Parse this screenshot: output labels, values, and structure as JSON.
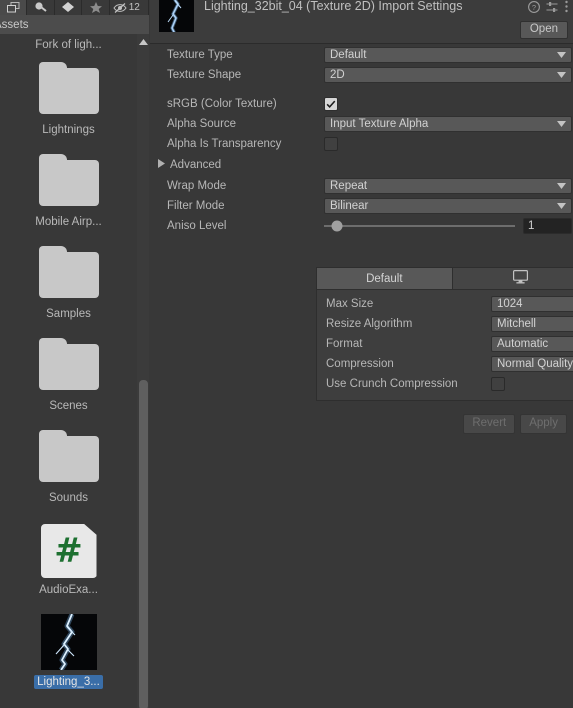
{
  "window": {
    "background_color": "#383838",
    "accent_selection_color": "#3a6ea8"
  },
  "gizmo_toolbar": {
    "icons": [
      "layers-2d-icon",
      "audio-icon",
      "effects-icon",
      "gizmos-star-icon",
      "visibility-eye-icon"
    ],
    "hidden_count": "12"
  },
  "project_panel": {
    "breadcrumb": "Assets",
    "top_partial_item": "Fork of ligh...",
    "scrollbar": {
      "up_arrow_icon": "chevron-up-icon"
    },
    "assets": [
      {
        "label": "Lightnings",
        "kind": "folder",
        "selected": false
      },
      {
        "label": "Mobile Airp...",
        "kind": "folder",
        "selected": false
      },
      {
        "label": "Samples",
        "kind": "folder",
        "selected": false
      },
      {
        "label": "Scenes",
        "kind": "folder",
        "selected": false
      },
      {
        "label": "Sounds",
        "kind": "folder",
        "selected": false
      },
      {
        "label": "AudioExa...",
        "kind": "csharp-script",
        "selected": false
      },
      {
        "label": "Lighting_3...",
        "kind": "texture",
        "selected": true
      }
    ]
  },
  "inspector": {
    "title": "Lighting_32bit_04 (Texture 2D) Import Settings",
    "preview_thumbnail": "lightning-texture-thumbnail",
    "header_icons": [
      "help-icon",
      "preset-settings-icon",
      "more-menu-icon"
    ],
    "open_button": "Open",
    "properties": [
      {
        "label": "Texture Type",
        "control": "dropdown",
        "value": "Default"
      },
      {
        "label": "Texture Shape",
        "control": "dropdown",
        "value": "2D"
      },
      {
        "label": "sRGB (Color Texture)",
        "control": "checkbox",
        "checked": true
      },
      {
        "label": "Alpha Source",
        "control": "dropdown",
        "value": "Input Texture Alpha"
      },
      {
        "label": "Alpha Is Transparency",
        "control": "checkbox",
        "checked": false
      }
    ],
    "advanced": {
      "label": "Advanced",
      "expanded": false,
      "arrow_icon": "triangle-right-icon"
    },
    "advanced_properties": [
      {
        "label": "Wrap Mode",
        "control": "dropdown",
        "value": "Repeat"
      },
      {
        "label": "Filter Mode",
        "control": "dropdown",
        "value": "Bilinear"
      },
      {
        "label": "Aniso Level",
        "control": "slider",
        "value": "1",
        "slider_percent": 7
      }
    ],
    "platform_tabs": [
      {
        "label": "Default",
        "icon": "",
        "active": true
      },
      {
        "label": "",
        "icon": "standalone-monitor-icon",
        "active": false
      },
      {
        "label": "",
        "icon": "windows-store-grid-icon",
        "active": false
      }
    ],
    "platform_properties": [
      {
        "label": "Max Size",
        "control": "dropdown",
        "value": "1024"
      },
      {
        "label": "Resize Algorithm",
        "control": "dropdown",
        "value": "Mitchell"
      },
      {
        "label": "Format",
        "control": "dropdown",
        "value": "Automatic"
      },
      {
        "label": "Compression",
        "control": "dropdown",
        "value": "Normal Quality"
      },
      {
        "label": "Use Crunch Compression",
        "control": "checkbox",
        "checked": false
      }
    ],
    "actions": [
      {
        "label": "Revert",
        "enabled": false
      },
      {
        "label": "Apply",
        "enabled": false
      }
    ]
  }
}
